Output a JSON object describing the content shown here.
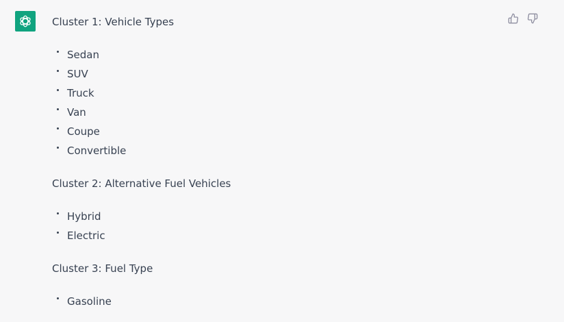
{
  "avatar": {
    "icon": "openai-logo-icon",
    "bg_color": "#10a37f"
  },
  "feedback": {
    "like_icon": "thumbs-up-icon",
    "dislike_icon": "thumbs-down-icon"
  },
  "clusters": [
    {
      "title": "Cluster 1: Vehicle Types",
      "items": [
        "Sedan",
        "SUV",
        "Truck",
        "Van",
        "Coupe",
        "Convertible"
      ]
    },
    {
      "title": "Cluster 2: Alternative Fuel Vehicles",
      "items": [
        "Hybrid",
        "Electric"
      ]
    },
    {
      "title": "Cluster 3: Fuel Type",
      "items": [
        "Gasoline"
      ]
    }
  ]
}
